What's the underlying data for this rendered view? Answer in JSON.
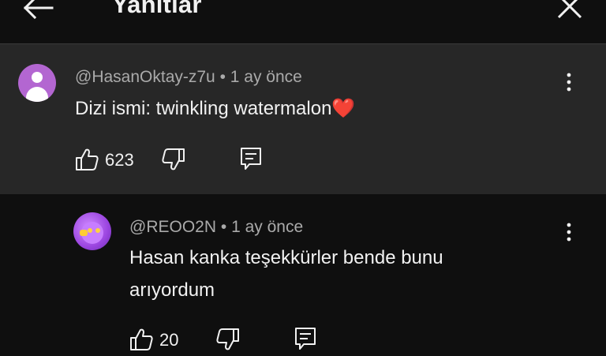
{
  "header": {
    "title": "Yanıtlar"
  },
  "parent_comment": {
    "handle": "@HasanOktay-z7u",
    "time": "1 ay önce",
    "text": "Dizi ismi: twinkling watermalon",
    "emoji": "❤️",
    "likes": "623"
  },
  "reply": {
    "handle": "@REOO2N",
    "time": "1 ay önce",
    "text_line1": "Hasan kanka teşekkürler bende bunu",
    "text_line2": "arıyordum",
    "likes": "20"
  },
  "separator": "•",
  "colors": {
    "background": "#0f0f0f",
    "highlight": "#272727",
    "meta_text": "#aaaaaa",
    "text": "#f1f1f1",
    "divider": "#3a3a3a"
  },
  "icons": [
    "arrow-left-icon",
    "close-icon",
    "more-vert-icon",
    "thumb-up-icon",
    "thumb-down-icon",
    "reply-icon"
  ]
}
